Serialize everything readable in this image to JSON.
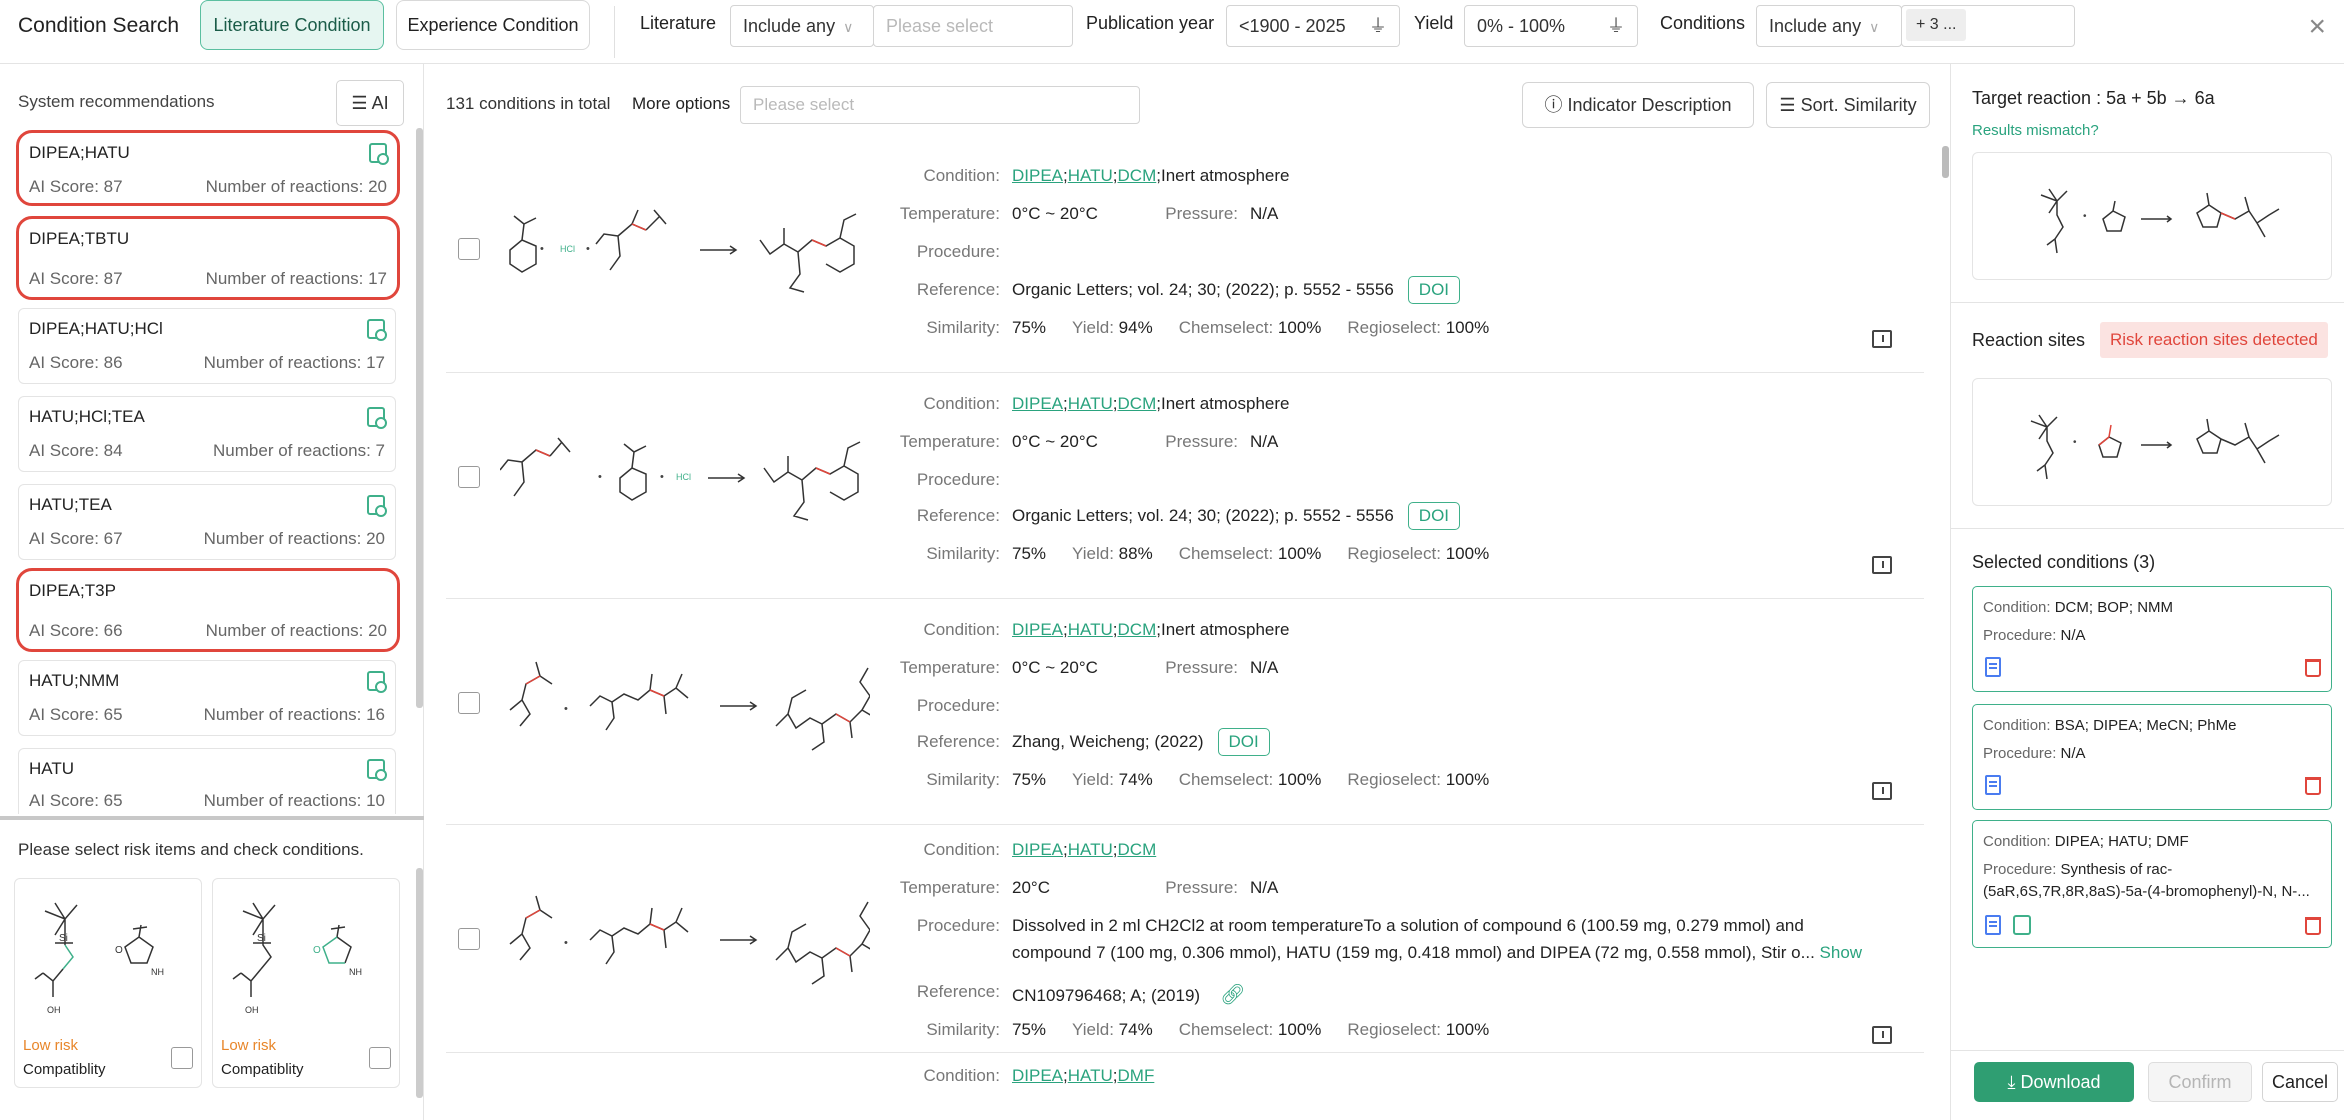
{
  "topbar": {
    "title": "Condition Search",
    "tab_literature": "Literature Condition",
    "tab_experience": "Experience Condition",
    "literature_label": "Literature",
    "literature_mode": "Include any",
    "literature_placeholder": "Please select",
    "pubyear_label": "Publication year",
    "pubyear_value": "<1900 - 2025",
    "yield_label": "Yield",
    "yield_value": "0% - 100%",
    "conditions_label": "Conditions",
    "conditions_mode": "Include any",
    "conditions_more": "+ 3 ..."
  },
  "left": {
    "header": "System recommendations",
    "ai_label": "AI",
    "recs": [
      {
        "name": "DIPEA;HATU",
        "score": "AI Score: 87",
        "count": "Number of reactions: 20",
        "highlight": true
      },
      {
        "name": "DIPEA;TBTU",
        "score": "AI Score: 87",
        "count": "Number of reactions: 17",
        "highlight": true
      },
      {
        "name": "DIPEA;HATU;HCl",
        "score": "AI Score: 86",
        "count": "Number of reactions: 17",
        "highlight": false
      },
      {
        "name": "HATU;HCl;TEA",
        "score": "AI Score: 84",
        "count": "Number of reactions: 7",
        "highlight": false
      },
      {
        "name": "HATU;TEA",
        "score": "AI Score: 67",
        "count": "Number of reactions: 20",
        "highlight": false
      },
      {
        "name": "DIPEA;T3P",
        "score": "AI Score: 66",
        "count": "Number of reactions: 20",
        "highlight": true
      },
      {
        "name": "HATU;NMM",
        "score": "AI Score: 65",
        "count": "Number of reactions: 16",
        "highlight": false
      },
      {
        "name": "HATU",
        "score": "AI Score: 65",
        "count": "Number of reactions: 10",
        "highlight": false
      }
    ],
    "risk_header": "Please select risk items and check conditions.",
    "risk_cards": [
      {
        "level": "Low risk",
        "label": "Compatiblity"
      },
      {
        "level": "Low risk",
        "label": "Compatiblity"
      }
    ]
  },
  "middle": {
    "total": "131 conditions in total",
    "more_options": "More options",
    "more_placeholder": "Please select",
    "indicator_btn": "Indicator Description",
    "sort_btn": "Sort. Similarity",
    "labels": {
      "condition": "Condition:",
      "temperature": "Temperature:",
      "pressure": "Pressure:",
      "procedure": "Procedure:",
      "reference": "Reference:",
      "similarity": "Similarity:",
      "yield": "Yield:",
      "chemselect": "Chemselect:",
      "regioselect": "Regioselect:"
    },
    "doi": "DOI",
    "show": "Show",
    "entries": [
      {
        "c1": "DIPEA",
        "c2": "HATU",
        "c3": "DCM",
        "extra": "Inert atmosphere",
        "temperature": "0°C ~ 20°C",
        "pressure": "N/A",
        "procedure": "",
        "reference": "Organic Letters; vol. 24; 30; (2022); p. 5552 - 5556",
        "similarity": "75%",
        "yield": "94%",
        "chemselect": "100%",
        "regioselect": "100%"
      },
      {
        "c1": "DIPEA",
        "c2": "HATU",
        "c3": "DCM",
        "extra": "Inert atmosphere",
        "temperature": "0°C ~ 20°C",
        "pressure": "N/A",
        "procedure": "",
        "reference": "Organic Letters; vol. 24; 30; (2022); p. 5552 - 5556",
        "similarity": "75%",
        "yield": "88%",
        "chemselect": "100%",
        "regioselect": "100%"
      },
      {
        "c1": "DIPEA",
        "c2": "HATU",
        "c3": "DCM",
        "extra": "Inert atmosphere",
        "temperature": "0°C ~ 20°C",
        "pressure": "N/A",
        "procedure": "",
        "reference": "Zhang, Weicheng; (2022)",
        "similarity": "75%",
        "yield": "74%",
        "chemselect": "100%",
        "regioselect": "100%"
      },
      {
        "c1": "DIPEA",
        "c2": "HATU",
        "c3": "DCM",
        "extra": "",
        "temperature": "20°C",
        "pressure": "N/A",
        "procedure_line1": "Dissolved in 2 ml CH2Cl2 at room temperatureTo a solution of compound 6 (100.59 mg, 0.279 mmol) and",
        "procedure_line2": "compound 7 (100 mg, 0.306 mmol), HATU (159 mg, 0.418 mmol) and DIPEA (72 mg, 0.558 mmol), Stir o...",
        "reference": "CN109796468; A; (2019)",
        "similarity": "75%",
        "yield": "74%",
        "chemselect": "100%",
        "regioselect": "100%"
      },
      {
        "c1": "DIPEA",
        "c2": "HATU",
        "c3": "DMF"
      }
    ]
  },
  "right": {
    "target": "Target reaction : 5a + 5b → 6a",
    "mismatch": "Results mismatch?",
    "sites_title": "Reaction sites",
    "risk_badge": "Risk reaction sites detected",
    "selected_title": "Selected conditions (3)",
    "selected": [
      {
        "condition": "DCM; BOP; NMM",
        "procedure": "N/A"
      },
      {
        "condition": "BSA; DIPEA; MeCN; PhMe",
        "procedure": "N/A"
      },
      {
        "condition": "DIPEA; HATU; DMF",
        "procedure_l1": "Synthesis of rac-",
        "procedure_l2": "(5aR,6S,7R,8R,8aS)-5a-(4-bromophenyl)-N, N-..."
      }
    ],
    "cond_label": "Condition:",
    "proc_label": "Procedure:",
    "download": "Download",
    "confirm": "Confirm",
    "cancel": "Cancel"
  },
  "colors": {
    "accent": "#2aa37e",
    "highlight": "#e0463c",
    "risk": "#e8862a"
  }
}
